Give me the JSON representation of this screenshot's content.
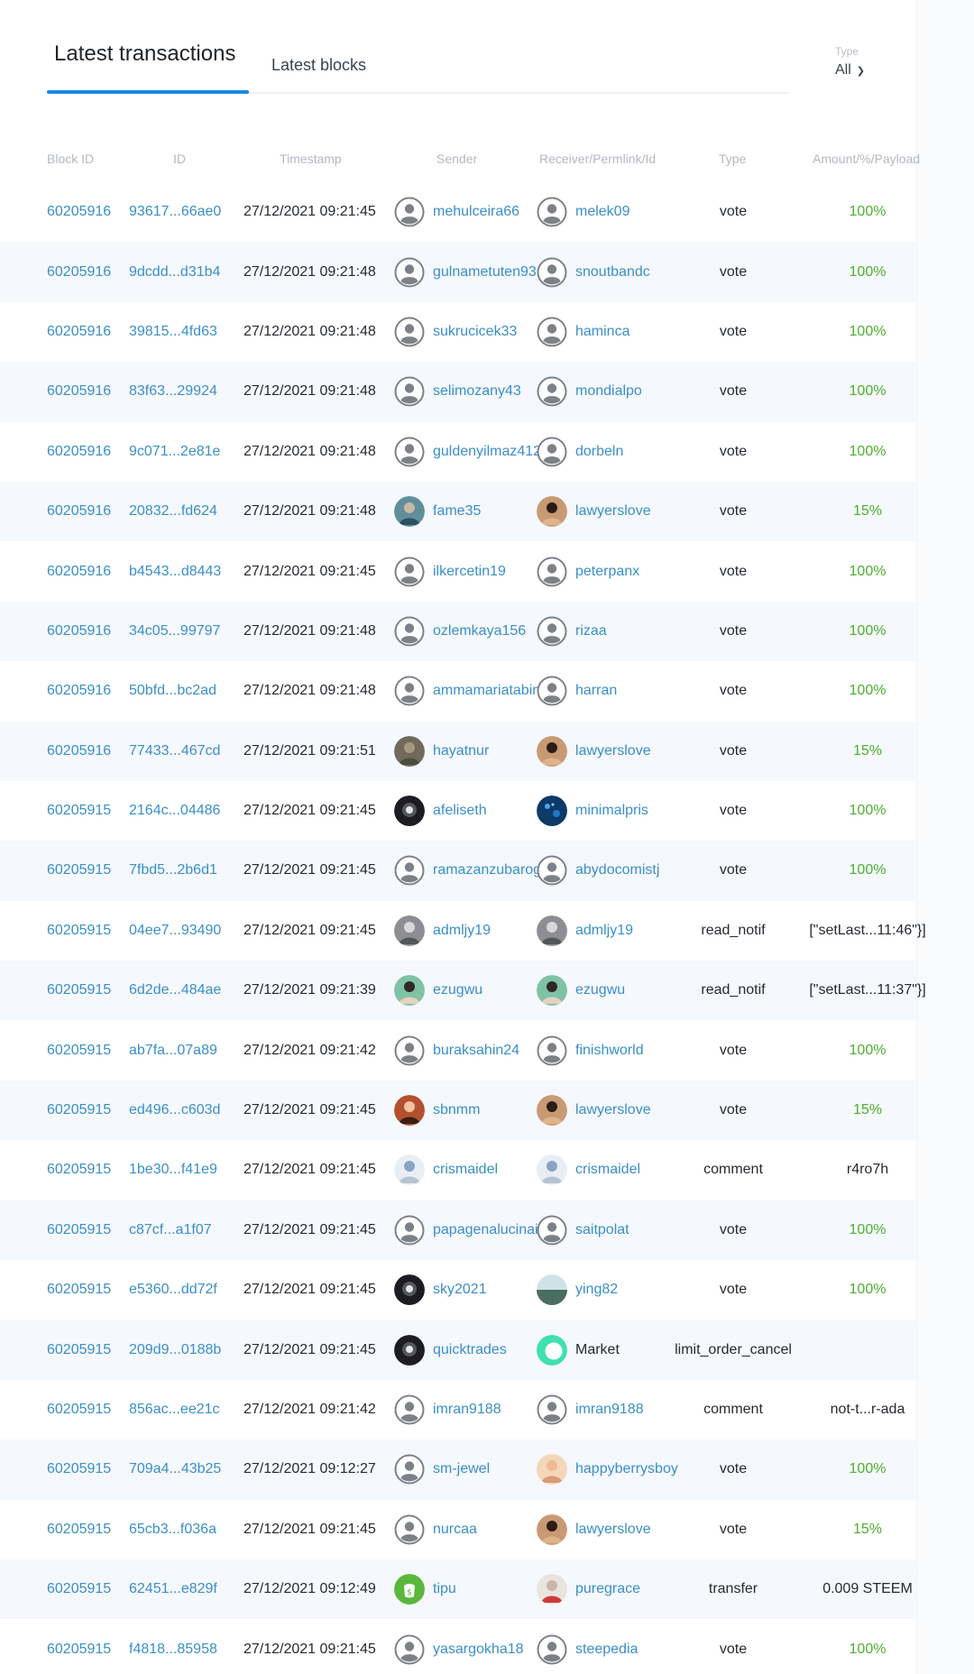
{
  "tabs": {
    "active": "Latest transactions",
    "other": "Latest blocks"
  },
  "filter": {
    "label": "Type",
    "value": "All"
  },
  "columns": {
    "block_id": "Block ID",
    "id": "ID",
    "timestamp": "Timestamp",
    "sender": "Sender",
    "receiver": "Receiver/Permlink/Id",
    "type": "Type",
    "amount": "Amount/%/Payload"
  },
  "colors": {
    "accent": "#1e88e5",
    "link": "#3b8fc7",
    "positive": "#4caf2f",
    "row_alt": "#f5f8fc"
  },
  "transactions": [
    {
      "block": "60205916",
      "id": "93617...66ae0",
      "ts": "27/12/2021 09:21:45",
      "sender": "mehulceira66",
      "s_av": "default",
      "receiver": "melek09",
      "r_av": "default",
      "r_link": true,
      "type": "vote",
      "amount": "100%",
      "amt_style": "green"
    },
    {
      "block": "60205916",
      "id": "9dcdd...d31b4",
      "ts": "27/12/2021 09:21:48",
      "sender": "gulnametuten93",
      "s_av": "default",
      "receiver": "snoutbandc",
      "r_av": "default",
      "r_link": true,
      "type": "vote",
      "amount": "100%",
      "amt_style": "green"
    },
    {
      "block": "60205916",
      "id": "39815...4fd63",
      "ts": "27/12/2021 09:21:48",
      "sender": "sukrucicek33",
      "s_av": "default",
      "receiver": "haminca",
      "r_av": "default",
      "r_link": true,
      "type": "vote",
      "amount": "100%",
      "amt_style": "green"
    },
    {
      "block": "60205916",
      "id": "83f63...29924",
      "ts": "27/12/2021 09:21:48",
      "sender": "selimozany43",
      "s_av": "default",
      "receiver": "mondialpo",
      "r_av": "default",
      "r_link": true,
      "type": "vote",
      "amount": "100%",
      "amt_style": "green"
    },
    {
      "block": "60205916",
      "id": "9c071...2e81e",
      "ts": "27/12/2021 09:21:48",
      "sender": "guldenyilmaz412",
      "s_av": "default",
      "receiver": "dorbeln",
      "r_av": "default",
      "r_link": true,
      "type": "vote",
      "amount": "100%",
      "amt_style": "green"
    },
    {
      "block": "60205916",
      "id": "20832...fd624",
      "ts": "27/12/2021 09:21:48",
      "sender": "fame35",
      "s_av": "photo-teal",
      "receiver": "lawyerslove",
      "r_av": "photo-portrait",
      "r_link": true,
      "type": "vote",
      "amount": "15%",
      "amt_style": "green"
    },
    {
      "block": "60205916",
      "id": "b4543...d8443",
      "ts": "27/12/2021 09:21:45",
      "sender": "ilkercetin19",
      "s_av": "default",
      "receiver": "peterpanx",
      "r_av": "default",
      "r_link": true,
      "type": "vote",
      "amount": "100%",
      "amt_style": "green"
    },
    {
      "block": "60205916",
      "id": "34c05...99797",
      "ts": "27/12/2021 09:21:48",
      "sender": "ozlemkaya156",
      "s_av": "default",
      "receiver": "rizaa",
      "r_av": "default",
      "r_link": true,
      "type": "vote",
      "amount": "100%",
      "amt_style": "green"
    },
    {
      "block": "60205916",
      "id": "50bfd...bc2ad",
      "ts": "27/12/2021 09:21:48",
      "sender": "ammamariatabina",
      "s_av": "default",
      "receiver": "harran",
      "r_av": "default",
      "r_link": true,
      "type": "vote",
      "amount": "100%",
      "amt_style": "green"
    },
    {
      "block": "60205916",
      "id": "77433...467cd",
      "ts": "27/12/2021 09:21:51",
      "sender": "hayatnur",
      "s_av": "photo-earth",
      "receiver": "lawyerslove",
      "r_av": "photo-portrait",
      "r_link": true,
      "type": "vote",
      "amount": "15%",
      "amt_style": "green"
    },
    {
      "block": "60205915",
      "id": "2164c...04486",
      "ts": "27/12/2021 09:21:45",
      "sender": "afeliseth",
      "s_av": "photo-dark",
      "receiver": "minimalpris",
      "r_av": "photo-galaxy",
      "r_link": true,
      "type": "vote",
      "amount": "100%",
      "amt_style": "green"
    },
    {
      "block": "60205915",
      "id": "7fbd5...2b6d1",
      "ts": "27/12/2021 09:21:45",
      "sender": "ramazanzubaroglu",
      "s_av": "default",
      "receiver": "abydocomistj",
      "r_av": "default",
      "r_link": true,
      "type": "vote",
      "amount": "100%",
      "amt_style": "green"
    },
    {
      "block": "60205915",
      "id": "04ee7...93490",
      "ts": "27/12/2021 09:21:45",
      "sender": "admljy19",
      "s_av": "photo-gray",
      "receiver": "admljy19",
      "r_av": "photo-gray",
      "r_link": true,
      "type": "read_notif",
      "amount": "[\"setLast...11:46\"}]",
      "amt_style": "dark"
    },
    {
      "block": "60205915",
      "id": "6d2de...484ae",
      "ts": "27/12/2021 09:21:39",
      "sender": "ezugwu",
      "s_av": "photo-face",
      "receiver": "ezugwu",
      "r_av": "photo-face",
      "r_link": true,
      "type": "read_notif",
      "amount": "[\"setLast...11:37\"}]",
      "amt_style": "dark"
    },
    {
      "block": "60205915",
      "id": "ab7fa...07a89",
      "ts": "27/12/2021 09:21:42",
      "sender": "buraksahin24",
      "s_av": "default",
      "receiver": "finishworld",
      "r_av": "default",
      "r_link": true,
      "type": "vote",
      "amount": "100%",
      "amt_style": "green"
    },
    {
      "block": "60205915",
      "id": "ed496...c603d",
      "ts": "27/12/2021 09:21:45",
      "sender": "sbnmm",
      "s_av": "photo-warm",
      "receiver": "lawyerslove",
      "r_av": "photo-portrait",
      "r_link": true,
      "type": "vote",
      "amount": "15%",
      "amt_style": "green"
    },
    {
      "block": "60205915",
      "id": "1be30...f41e9",
      "ts": "27/12/2021 09:21:45",
      "sender": "crismaidel",
      "s_av": "photo-light",
      "receiver": "crismaidel",
      "r_av": "photo-light",
      "r_link": true,
      "type": "comment",
      "amount": "r4ro7h",
      "amt_style": "dark"
    },
    {
      "block": "60205915",
      "id": "c87cf...a1f07",
      "ts": "27/12/2021 09:21:45",
      "sender": "papagenalucinai",
      "s_av": "default",
      "receiver": "saitpolat",
      "r_av": "default",
      "r_link": true,
      "type": "vote",
      "amount": "100%",
      "amt_style": "green"
    },
    {
      "block": "60205915",
      "id": "e5360...dd72f",
      "ts": "27/12/2021 09:21:45",
      "sender": "sky2021",
      "s_av": "photo-dark",
      "receiver": "ying82",
      "r_av": "photo-landscape",
      "r_link": true,
      "type": "vote",
      "amount": "100%",
      "amt_style": "green"
    },
    {
      "block": "60205915",
      "id": "209d9...0188b",
      "ts": "27/12/2021 09:21:45",
      "sender": "quicktrades",
      "s_av": "photo-dark",
      "receiver": "Market",
      "r_av": "market",
      "r_link": false,
      "type": "limit_order_cancel",
      "amount": "",
      "amt_style": "dark"
    },
    {
      "block": "60205915",
      "id": "856ac...ee21c",
      "ts": "27/12/2021 09:21:42",
      "sender": "imran9188",
      "s_av": "default",
      "receiver": "imran9188",
      "r_av": "default",
      "r_link": true,
      "type": "comment",
      "amount": "not-t...r-ada",
      "amt_style": "dark"
    },
    {
      "block": "60205915",
      "id": "709a4...43b25",
      "ts": "27/12/2021 09:12:27",
      "sender": "sm-jewel",
      "s_av": "default",
      "receiver": "happyberrysboy",
      "r_av": "photo-cartoon",
      "r_link": true,
      "type": "vote",
      "amount": "100%",
      "amt_style": "green"
    },
    {
      "block": "60205915",
      "id": "65cb3...f036a",
      "ts": "27/12/2021 09:21:45",
      "sender": "nurcaa",
      "s_av": "default",
      "receiver": "lawyerslove",
      "r_av": "photo-portrait",
      "r_link": true,
      "type": "vote",
      "amount": "15%",
      "amt_style": "green"
    },
    {
      "block": "60205915",
      "id": "62451...e829f",
      "ts": "27/12/2021 09:12:49",
      "sender": "tipu",
      "s_av": "tipu",
      "receiver": "puregrace",
      "r_av": "photo-red",
      "r_link": true,
      "type": "transfer",
      "amount": "0.009 STEEM",
      "amt_style": "dark"
    },
    {
      "block": "60205915",
      "id": "f4818...85958",
      "ts": "27/12/2021 09:21:45",
      "sender": "yasargokha18",
      "s_av": "default",
      "receiver": "steepedia",
      "r_av": "default",
      "r_link": true,
      "type": "vote",
      "amount": "100%",
      "amt_style": "green"
    }
  ]
}
